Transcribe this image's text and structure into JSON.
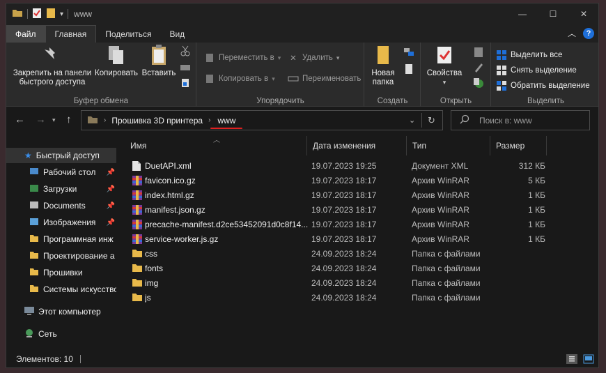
{
  "window": {
    "title": "www"
  },
  "menu": {
    "tabs": [
      "Файл",
      "Главная",
      "Поделиться",
      "Вид"
    ],
    "help": "?"
  },
  "ribbon": {
    "clipboard": {
      "pin_label": "Закрепить на панели быстрого доступа",
      "copy_label": "Копировать",
      "paste_label": "Вставить",
      "group_label": "Буфер обмена"
    },
    "organize": {
      "move_label": "Переместить в",
      "copyto_label": "Копировать в",
      "delete_label": "Удалить",
      "rename_label": "Переименовать",
      "group_label": "Упорядочить"
    },
    "create": {
      "newfolder_label": "Новая папка",
      "group_label": "Создать"
    },
    "open": {
      "properties_label": "Свойства",
      "group_label": "Открыть"
    },
    "select": {
      "select_all": "Выделить все",
      "select_none": "Снять выделение",
      "invert": "Обратить выделение",
      "group_label": "Выделить"
    }
  },
  "address": {
    "parent": "Прошивка 3D принтера",
    "current": "www",
    "search_placeholder": "Поиск в: www"
  },
  "sidebar": {
    "items": [
      {
        "label": "Быстрый доступ"
      },
      {
        "label": "Рабочий стол"
      },
      {
        "label": "Загрузки"
      },
      {
        "label": "Documents"
      },
      {
        "label": "Изображения"
      },
      {
        "label": "Программная инж"
      },
      {
        "label": "Проектирование а"
      },
      {
        "label": "Прошивки"
      },
      {
        "label": "Системы искусство"
      },
      {
        "label": "Этот компьютер"
      },
      {
        "label": "Сеть"
      }
    ]
  },
  "columns": {
    "name": "Имя",
    "date": "Дата изменения",
    "type": "Тип",
    "size": "Размер"
  },
  "files": [
    {
      "name": "DuetAPI.xml",
      "date": "19.07.2023 19:25",
      "type": "Документ XML",
      "size": "312 КБ",
      "icon": "xml-file-icon"
    },
    {
      "name": "favicon.ico.gz",
      "date": "19.07.2023 18:17",
      "type": "Архив WinRAR",
      "size": "5 КБ",
      "icon": "winrar-archive-icon"
    },
    {
      "name": "index.html.gz",
      "date": "19.07.2023 18:17",
      "type": "Архив WinRAR",
      "size": "1 КБ",
      "icon": "winrar-archive-icon"
    },
    {
      "name": "manifest.json.gz",
      "date": "19.07.2023 18:17",
      "type": "Архив WinRAR",
      "size": "1 КБ",
      "icon": "winrar-archive-icon"
    },
    {
      "name": "precache-manifest.d2ce53452091d0c8f14...",
      "date": "19.07.2023 18:17",
      "type": "Архив WinRAR",
      "size": "1 КБ",
      "icon": "winrar-archive-icon"
    },
    {
      "name": "service-worker.js.gz",
      "date": "19.07.2023 18:17",
      "type": "Архив WinRAR",
      "size": "1 КБ",
      "icon": "winrar-archive-icon"
    },
    {
      "name": "css",
      "date": "24.09.2023 18:24",
      "type": "Папка с файлами",
      "size": "",
      "icon": "folder-icon"
    },
    {
      "name": "fonts",
      "date": "24.09.2023 18:24",
      "type": "Папка с файлами",
      "size": "",
      "icon": "folder-icon"
    },
    {
      "name": "img",
      "date": "24.09.2023 18:24",
      "type": "Папка с файлами",
      "size": "",
      "icon": "folder-icon"
    },
    {
      "name": "js",
      "date": "24.09.2023 18:24",
      "type": "Папка с файлами",
      "size": "",
      "icon": "folder-icon"
    }
  ],
  "status": {
    "count": "Элементов: 10"
  },
  "colors": {
    "accent": "#1e6fd9",
    "folder": "#e8b94a",
    "underline": "#e02020"
  }
}
